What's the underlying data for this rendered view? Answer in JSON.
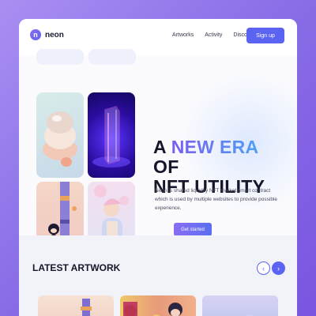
{
  "header": {
    "logo_letter": "n",
    "logo_text": "neon",
    "nav": [
      "Artworks",
      "Activity",
      "Discover"
    ],
    "signup_label": "Sign up"
  },
  "hero": {
    "title_line1_a": "A ",
    "title_line1_accent": "NEW ERA",
    "title_line1_b": " OF",
    "title_line2": "NFT UTILITY",
    "description": "Neon is shared liquidity NFT market smart contract which is used by multiple websites to provide possible experience.",
    "cta_label": "Get started"
  },
  "latest": {
    "title": "LATEST ARTWORK",
    "prev_icon": "‹",
    "next_icon": "›"
  },
  "colors": {
    "accent": "#5b63f2",
    "purple": "#8a6df2"
  }
}
